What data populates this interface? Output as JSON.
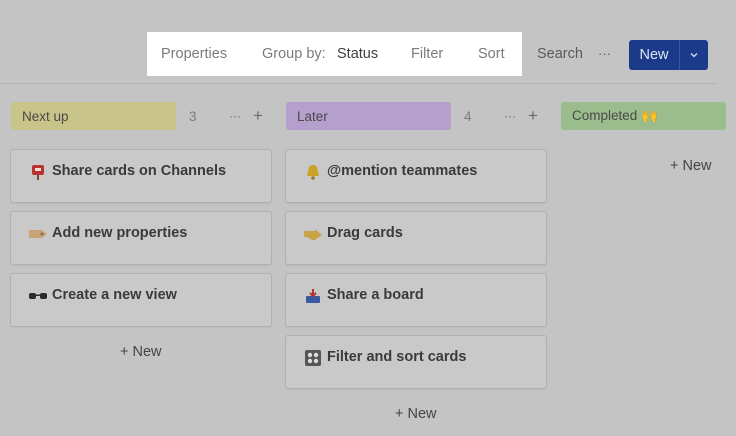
{
  "toolbar": {
    "properties": "Properties",
    "group_by_label": "Group by:",
    "group_by_value": "Status",
    "filter": "Filter",
    "sort": "Sort",
    "search": "Search",
    "more": "···",
    "new_button": "New",
    "new_dropdown_icon": "chevron-down-icon"
  },
  "columns": [
    {
      "name": "Next up",
      "count": "3",
      "color": "#c9c48a",
      "more": "···",
      "add": "+",
      "cards": [
        {
          "title": "Share cards on Channels",
          "icon": "mailbox-icon"
        },
        {
          "title": "Add new properties",
          "icon": "tag-icon"
        },
        {
          "title": "Create a new view",
          "icon": "glasses-icon"
        }
      ],
      "new_label": "+ New"
    },
    {
      "name": "Later",
      "count": "4",
      "color": "#b59fcc",
      "more": "···",
      "add": "+",
      "cards": [
        {
          "title": "@mention teammates",
          "icon": "bell-icon"
        },
        {
          "title": "Drag cards",
          "icon": "pointing-hand-icon"
        },
        {
          "title": "Share a board",
          "icon": "inbox-tray-icon"
        },
        {
          "title": "Filter and sort cards",
          "icon": "control-knobs-icon"
        }
      ],
      "new_label": "+ New"
    },
    {
      "name": "Completed 🙌",
      "color": "#9bbd8e",
      "cards": [],
      "new_label": "+ New"
    }
  ]
}
